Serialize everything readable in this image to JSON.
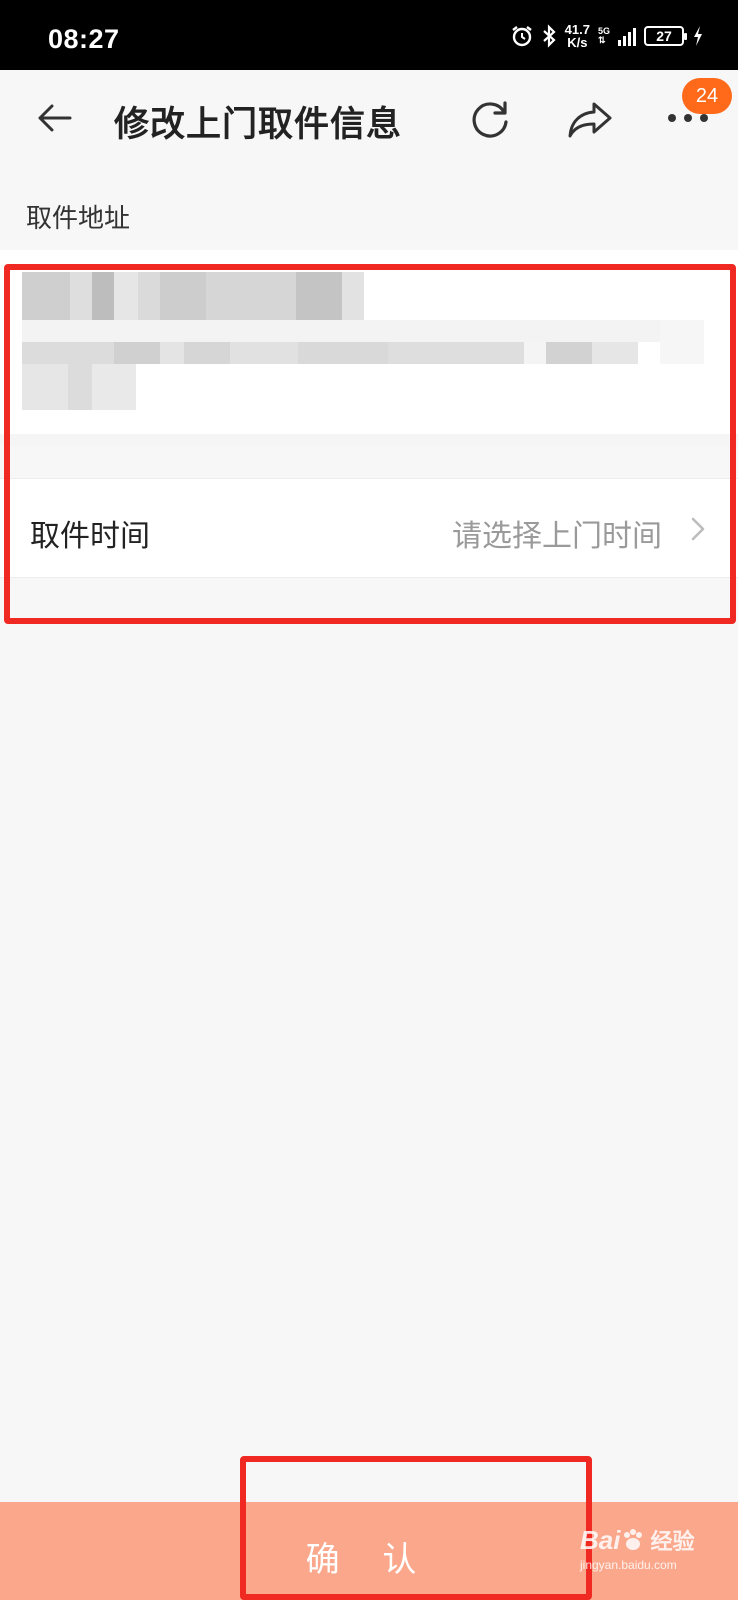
{
  "status_bar": {
    "time": "08:27",
    "net_speed_value": "41.7",
    "net_speed_unit": "K/s",
    "network_type": "5G",
    "battery": "27"
  },
  "nav": {
    "title": "修改上门取件信息",
    "badge_count": "24"
  },
  "section": {
    "address_label": "取件地址"
  },
  "pickup_time": {
    "label": "取件时间",
    "placeholder": "请选择上门时间"
  },
  "footer": {
    "confirm_label": "确 认"
  },
  "watermark": {
    "brand": "Bai",
    "cn": "经验",
    "url": "jingyan.baidu.com"
  },
  "colors": {
    "highlight": "#f02a22",
    "confirm_bg": "#fba78c",
    "badge_bg": "#ff6a1a"
  },
  "icons": [
    "alarm-icon",
    "bluetooth-icon",
    "signal-icon",
    "battery-icon",
    "charging-icon",
    "back-arrow-icon",
    "refresh-icon",
    "share-icon",
    "more-icon",
    "chevron-right-icon"
  ]
}
